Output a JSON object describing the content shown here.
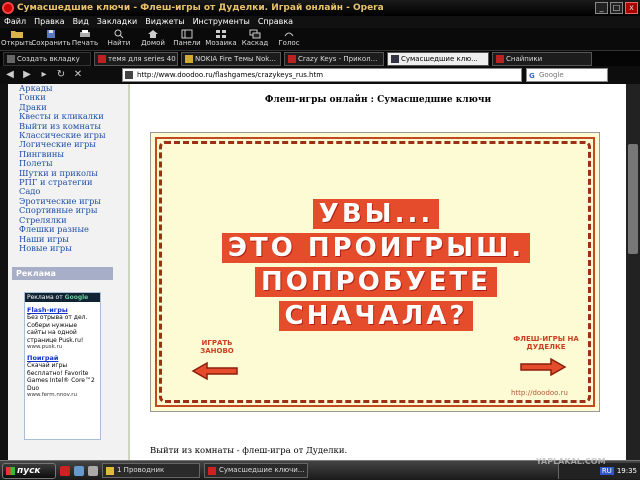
{
  "window": {
    "title": "Сумасшедшие ключи - Флеш-игры от Дуделки. Играй онлайн - Opera",
    "controls": [
      "_",
      "□",
      "x"
    ]
  },
  "menu": [
    "Файл",
    "Правка",
    "Вид",
    "Закладки",
    "Виджеты",
    "Инструменты",
    "Справка"
  ],
  "toolbar": [
    "Открыть",
    "Сохранить",
    "Печать",
    "Найти",
    "Домой",
    "Панели",
    "Мозаика",
    "Каскад",
    "Голос"
  ],
  "tabs": {
    "create_label": "Создать вкладку",
    "items": [
      {
        "label": "темя для series 40 б..."
      },
      {
        "label": "NOKIA Fire Темы Nok..."
      },
      {
        "label": "Crazy Keys - Прикол..."
      },
      {
        "label": "Сумасшедшие клю...",
        "active": true
      },
      {
        "label": "Снайпики"
      }
    ]
  },
  "address": {
    "url": "http://www.doodoo.ru/flashgames/crazykeys_rus.htm",
    "search_placeholder": "Google"
  },
  "sidebar": {
    "categories": [
      "Аркады",
      "Гонки",
      "Драки",
      "Квесты и кликалки",
      "Выйти из комнаты",
      "Классические игры",
      "Логические игры",
      "Пингвины",
      "Полеты",
      "Шутки и приколы",
      "РПГ и стратегии",
      "Садо",
      "Эротические игры",
      "Спортивные игры",
      "Стрелялки",
      "Флешки разные",
      "Наши игры",
      "Новые игры"
    ],
    "ad_header": "Реклама",
    "ads_by": "Реклама от",
    "ads_brand": "Google",
    "ads": [
      {
        "title": "Flash-игры",
        "text": "Без отрыва от дел. Собери нужные сайты на одной странице Pusk.ru!",
        "url": "www.pusk.ru"
      },
      {
        "title": "Поиграй",
        "text": "Скачай игры бесплатно! Favorite Games Intel® Core™2 Duo",
        "url": "www.ferm.nnov.ru"
      }
    ]
  },
  "main": {
    "title": "Флеш-игры онлайн : Сумасшедшие ключи",
    "game": {
      "message_lines": [
        "УВЫ...",
        "ЭТО ПРОИГРЫШ.",
        "ПОПРОБУЕТЕ",
        "СНАЧАЛА?"
      ],
      "play_again": "ИГРАТЬ ЗАНОВО",
      "more_games": "ФЛЕШ-ИГРЫ НА ДУДЕЛКЕ",
      "site": "http://doodoo.ru"
    },
    "description": "Выйти из комнаты - флеш-игра от Дуделки."
  },
  "taskbar": {
    "start": "пуск",
    "tasks": [
      "1 Проводник",
      "Сумасшедшие ключи..."
    ],
    "lang": "RU",
    "clock": "19:35",
    "watermark": "YAPLAKAL.COM"
  },
  "colors": {
    "accent": "#e44c2c",
    "link": "#1d4fa6",
    "game_bg": "#fdfbd4"
  }
}
